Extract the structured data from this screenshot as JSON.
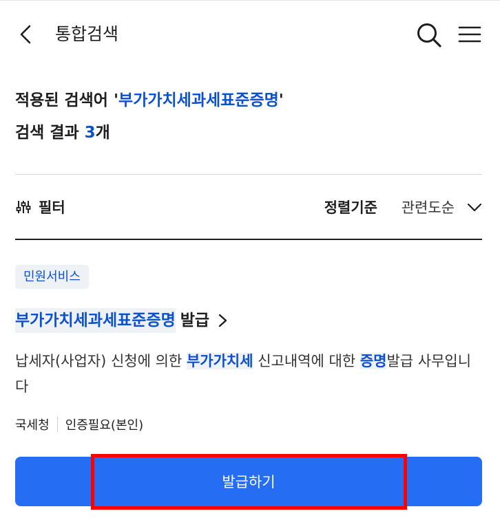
{
  "header": {
    "title": "통합검색",
    "back_icon": "chevron-left-icon",
    "search_icon": "search-icon",
    "menu_icon": "hamburger-menu-icon"
  },
  "summary": {
    "applied_prefix": "적용된 검색어 '",
    "applied_keyword": "부가가치세과세표준증명",
    "applied_suffix": "'",
    "result_prefix": "검색 결과 ",
    "result_count": "3",
    "result_suffix": "개"
  },
  "filter": {
    "label": "필터",
    "icon": "filter-sliders-icon"
  },
  "sort": {
    "title": "정렬기준",
    "value": "관련도순",
    "icon": "chevron-down-icon"
  },
  "result": {
    "category": "민원서비스",
    "title_keyword": "부가가치세과세표준증명",
    "title_rest": "발급",
    "title_icon": "chevron-right-icon",
    "desc_part1": "납세자(사업자) 신청에 의한 ",
    "desc_keyword1": "부가가치세",
    "desc_part2": " 신고내역에 대한 ",
    "desc_keyword2": "증명",
    "desc_part3": "발급 사무입니다",
    "agency": "국세청",
    "auth": "인증필요(본인)",
    "button_label": "발급하기"
  },
  "colors": {
    "accent": "#256ef4",
    "highlight_text": "#0b50d0",
    "highlight_bg": "#eef2f7",
    "annotation": "#ff0000"
  }
}
